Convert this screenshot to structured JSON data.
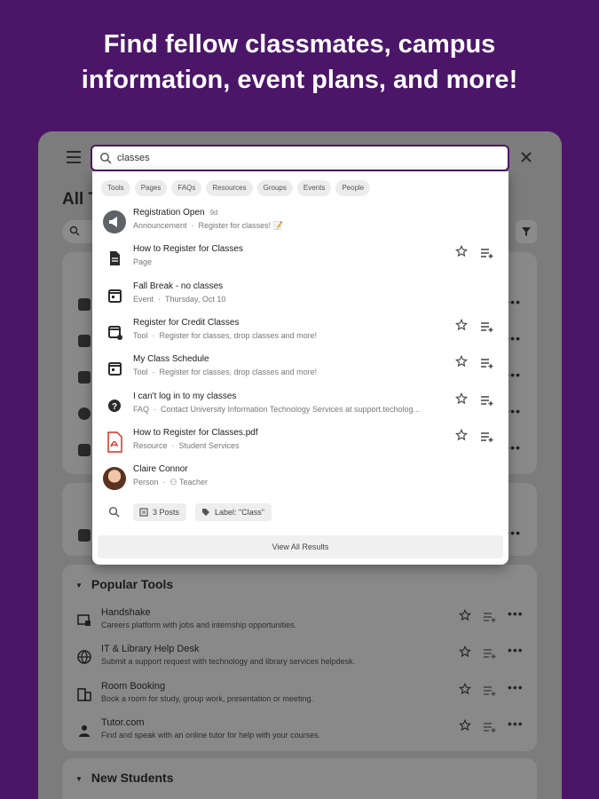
{
  "headline": {
    "line1": "Find fellow classmates, campus",
    "line2": "information, event plans, and more!"
  },
  "background_page": {
    "title": "All T",
    "search_hint": "S"
  },
  "search": {
    "value": "classes"
  },
  "filter_chips": [
    "Tools",
    "Pages",
    "FAQs",
    "Resources",
    "Groups",
    "Events",
    "People"
  ],
  "results": [
    {
      "title": "Registration Open",
      "time": "9d",
      "type": "Announcement",
      "detail": "Register for classes! 📝",
      "icon": "megaphone-icon",
      "actions": false
    },
    {
      "title": "How to Register for Classes",
      "type": "Page",
      "detail": "",
      "icon": "page-icon",
      "actions": true
    },
    {
      "title": "Fall Break - no classes",
      "type": "Event",
      "detail": "Thursday, Oct 10",
      "icon": "calendar-icon",
      "actions": false
    },
    {
      "title": "Register for Credit Classes",
      "type": "Tool",
      "detail": "Register for classes, drop classes and more!",
      "icon": "register-tool-icon",
      "actions": true
    },
    {
      "title": "My Class Schedule",
      "type": "Tool",
      "detail": "Register for classes, drop classes and more!",
      "icon": "calendar-icon",
      "actions": true
    },
    {
      "title": "I can't log in to my classes",
      "type": "FAQ",
      "detail": "Contact University Information Technology Services at support.techolog...",
      "icon": "help-icon",
      "actions": true
    },
    {
      "title": "How to Register for Classes.pdf",
      "type": "Resource",
      "detail": "Student Services",
      "icon": "pdf-icon",
      "actions": true
    },
    {
      "title": "Claire Connor",
      "type": "Person",
      "detail": "Teacher",
      "icon": "avatar",
      "actions": false
    }
  ],
  "footer": {
    "posts": "3 Posts",
    "label": "Label: \"Class\"",
    "view_all": "View All Results"
  },
  "popular_tools": {
    "header": "Popular Tools",
    "items": [
      {
        "title": "Handshake",
        "subtitle": "Careers platform with jobs and internship opportunities.",
        "icon": "handshake-icon"
      },
      {
        "title": "IT & Library Help Desk",
        "subtitle": "Submit a support request with technology and library services helpdesk.",
        "icon": "globe-icon"
      },
      {
        "title": "Room Booking",
        "subtitle": "Book a room for study, group work, presentation or meeting.",
        "icon": "building-icon"
      },
      {
        "title": "Tutor.com",
        "subtitle": "Find and speak with an online tutor for help with your courses.",
        "icon": "tutor-icon"
      }
    ]
  },
  "new_students": {
    "header": "New Students"
  },
  "colors": {
    "brand": "#4b1668",
    "overlay": "#7c7c7c",
    "panel": "#ffffff"
  }
}
